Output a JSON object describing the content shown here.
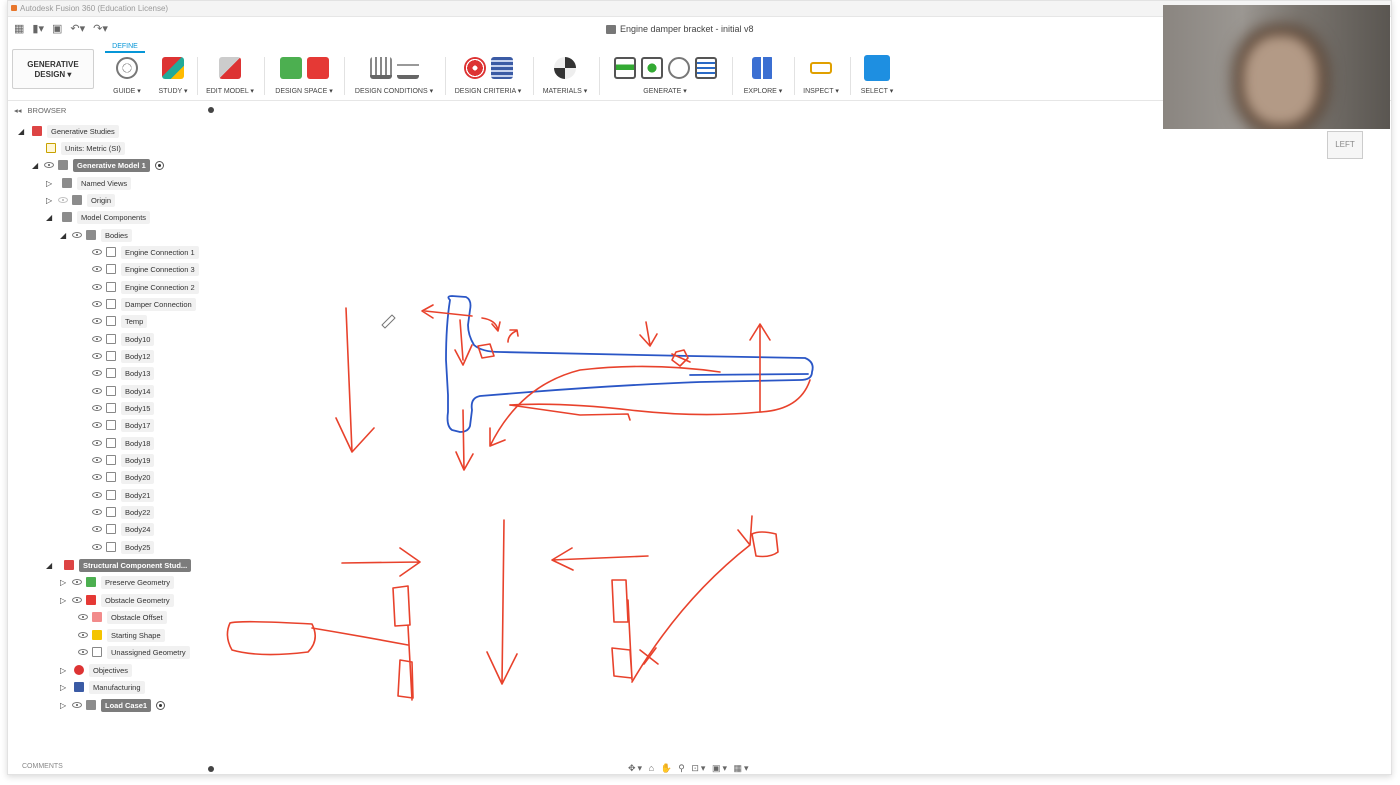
{
  "window": {
    "title": "Autodesk Fusion 360 (Education License)"
  },
  "document": {
    "title": "Engine damper bracket - initial v8"
  },
  "toolbar": {
    "workspace_label": "GENERATIVE DESIGN",
    "active_tab": "DEFINE",
    "groups": [
      {
        "label": "GUIDE ▾"
      },
      {
        "label": "STUDY ▾"
      },
      {
        "label": "EDIT MODEL ▾"
      },
      {
        "label": "DESIGN SPACE ▾"
      },
      {
        "label": "DESIGN CONDITIONS ▾"
      },
      {
        "label": "DESIGN CRITERIA ▾"
      },
      {
        "label": "MATERIALS ▾"
      },
      {
        "label": "GENERATE ▾"
      },
      {
        "label": "EXPLORE ▾"
      },
      {
        "label": "INSPECT ▾"
      },
      {
        "label": "SELECT ▾"
      }
    ]
  },
  "browser": {
    "title": "BROWSER",
    "nodes": [
      {
        "label": "Generative Studies"
      },
      {
        "label": "Units: Metric (SI)"
      },
      {
        "label": "Generative Model 1"
      },
      {
        "label": "Named Views"
      },
      {
        "label": "Origin"
      },
      {
        "label": "Model Components"
      },
      {
        "label": "Bodies"
      },
      {
        "label": "Engine Connection 1"
      },
      {
        "label": "Engine Connection 3"
      },
      {
        "label": "Engine Connection 2"
      },
      {
        "label": "Damper Connection"
      },
      {
        "label": "Temp"
      },
      {
        "label": "Body10"
      },
      {
        "label": "Body12"
      },
      {
        "label": "Body13"
      },
      {
        "label": "Body14"
      },
      {
        "label": "Body15"
      },
      {
        "label": "Body17"
      },
      {
        "label": "Body18"
      },
      {
        "label": "Body19"
      },
      {
        "label": "Body20"
      },
      {
        "label": "Body21"
      },
      {
        "label": "Body22"
      },
      {
        "label": "Body24"
      },
      {
        "label": "Body25"
      },
      {
        "label": "Structural Component Stud..."
      },
      {
        "label": "Preserve Geometry"
      },
      {
        "label": "Obstacle Geometry"
      },
      {
        "label": "Obstacle Offset"
      },
      {
        "label": "Starting Shape"
      },
      {
        "label": "Unassigned Geometry"
      },
      {
        "label": "Objectives"
      },
      {
        "label": "Manufacturing"
      },
      {
        "label": "Load Case1"
      }
    ]
  },
  "comments": {
    "title": "COMMENTS"
  },
  "viewcube": {
    "label": "LEFT"
  },
  "colors": {
    "accent": "#0696d7",
    "ink_red": "#e8422c",
    "ink_blue": "#2a56c6"
  }
}
